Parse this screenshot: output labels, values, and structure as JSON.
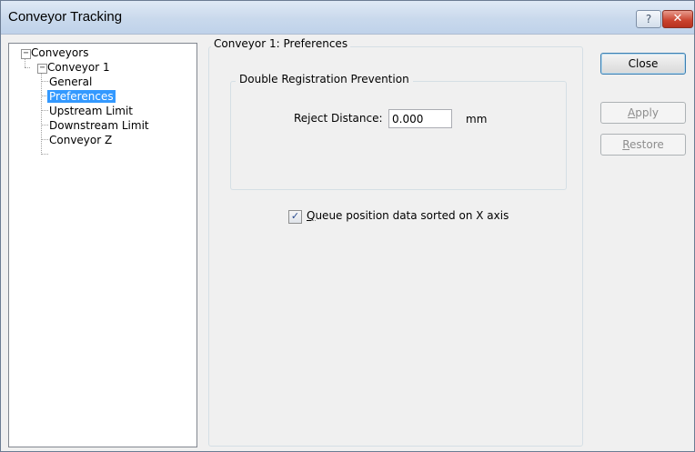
{
  "window": {
    "title": "Conveyor Tracking"
  },
  "titlebar_buttons": {
    "help": "?",
    "close": "✕"
  },
  "tree": {
    "root": "Conveyors",
    "child": "Conveyor 1",
    "items": [
      "General",
      "Preferences",
      "Upstream Limit",
      "Downstream Limit",
      "Conveyor Z"
    ],
    "selected": "Preferences"
  },
  "panel": {
    "title": "Conveyor 1: Preferences",
    "group_title": "Double Registration Prevention",
    "reject_label": "Reject Distance:",
    "reject_value": "0.000",
    "reject_unit": "mm",
    "queue_checkbox": {
      "mnemonic": "Q",
      "label_rest": "ueue position data sorted on X axis",
      "checked": true
    }
  },
  "buttons": {
    "close": "Close",
    "apply_mnemonic": "A",
    "apply_rest": "pply",
    "restore_mnemonic": "R",
    "restore_rest": "estore"
  }
}
